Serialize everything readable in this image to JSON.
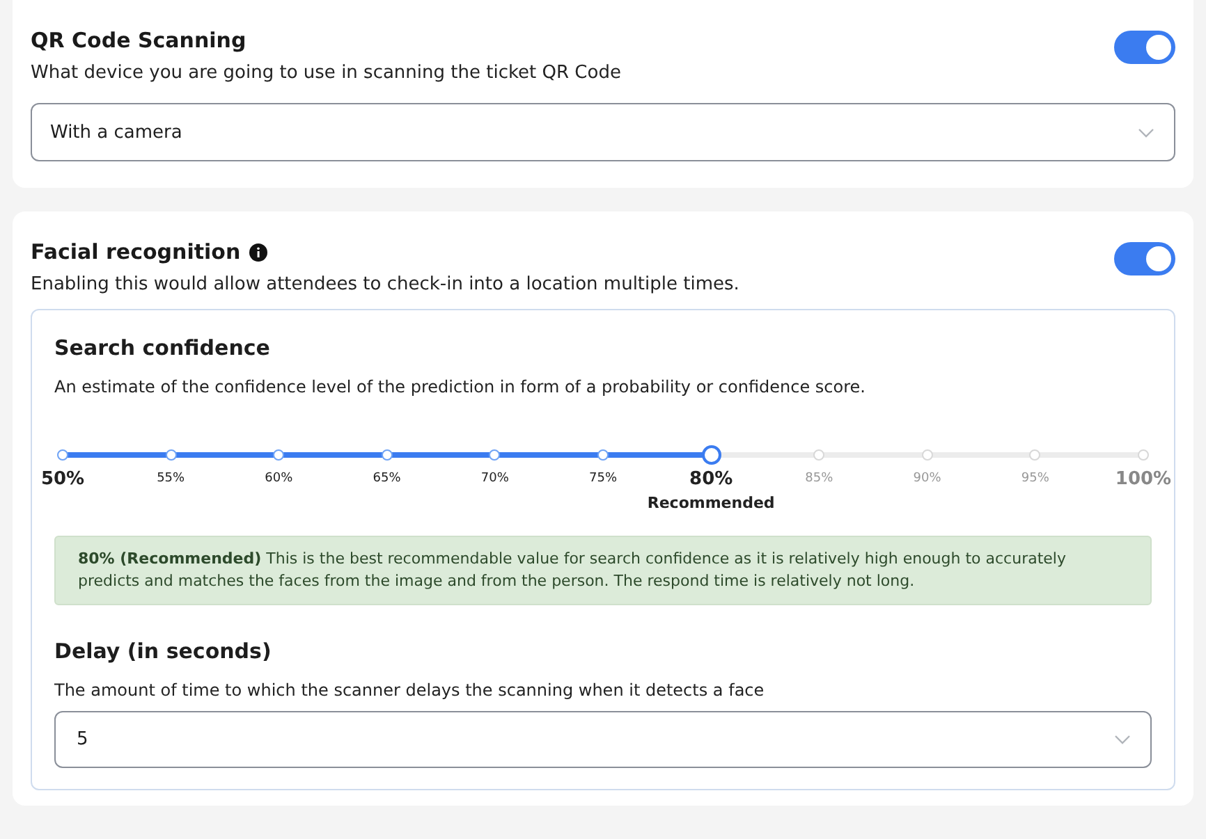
{
  "qr_scanning": {
    "title": "QR Code Scanning",
    "description": "What device you are going to use in scanning the ticket QR Code",
    "enabled": true,
    "device_select": {
      "value": "With a camera"
    }
  },
  "facial_recognition": {
    "title": "Facial recognition",
    "description": "Enabling this would allow attendees to check-in into a location multiple times.",
    "enabled": true,
    "search_confidence": {
      "title": "Search confidence",
      "description": "An estimate of the confidence level of the prediction in form of a probability or confidence score.",
      "slider": {
        "level": 0.6,
        "ticks": [
          {
            "label": "50%",
            "selected": false
          },
          {
            "label": "55%",
            "selected": false
          },
          {
            "label": "60%",
            "selected": false
          },
          {
            "label": "65%",
            "selected": false
          },
          {
            "label": "70%",
            "selected": false
          },
          {
            "label": "75%",
            "selected": false
          },
          {
            "label": "80%",
            "selected": true,
            "note": "Recommended"
          },
          {
            "label": "85%",
            "selected": false
          },
          {
            "label": "90%",
            "selected": false
          },
          {
            "label": "95%",
            "selected": false
          },
          {
            "label": "100%",
            "selected": false
          }
        ]
      },
      "info": "**80% (Recommended)** This is the best recommendable value for search confidence as it is relatively high enough to accurately predicts and matches the faces from the image and from the person. The respond time is relatively not long."
    },
    "delay": {
      "title": "Delay (in seconds)",
      "description": "The amount of time to which the scanner delays the scanning when it detects a face",
      "select": {
        "value": "5"
      }
    }
  }
}
